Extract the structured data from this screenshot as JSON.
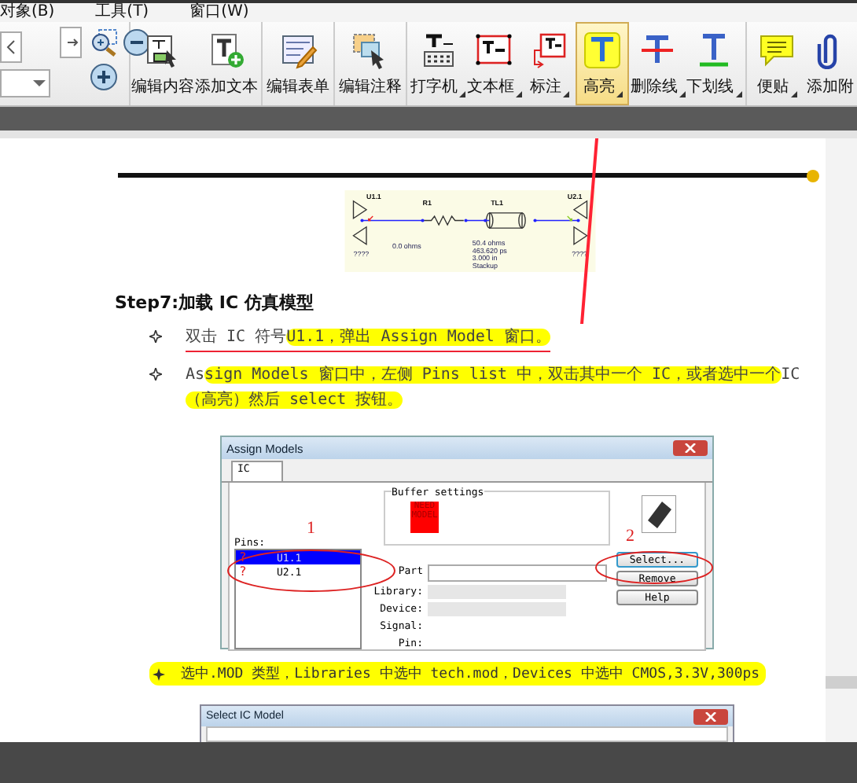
{
  "menu": [
    {
      "label": "对象(B)"
    },
    {
      "label": "工具(T)"
    },
    {
      "label": "窗口(W)"
    }
  ],
  "toolbar": [
    {
      "label": "编辑内容",
      "dropdown": false,
      "selected": false
    },
    {
      "label": "添加文本",
      "dropdown": false,
      "selected": false
    },
    {
      "label": "编辑表单",
      "dropdown": false,
      "selected": false
    },
    {
      "label": "编辑注释",
      "dropdown": false,
      "selected": false
    },
    {
      "label": "打字机",
      "dropdown": true,
      "selected": false
    },
    {
      "label": "文本框",
      "dropdown": true,
      "selected": false
    },
    {
      "label": "标注",
      "dropdown": true,
      "selected": false
    },
    {
      "label": "高亮",
      "dropdown": true,
      "selected": true
    },
    {
      "label": "删除线",
      "dropdown": true,
      "selected": false
    },
    {
      "label": "下划线",
      "dropdown": true,
      "selected": false
    },
    {
      "label": "便贴",
      "dropdown": true,
      "selected": false
    },
    {
      "label": "添加附",
      "dropdown": false,
      "selected": false
    }
  ],
  "document": {
    "schematic": {
      "labels": [
        "U1.1",
        "R1",
        "TL1",
        "U2.1",
        "0.0 ohms",
        "50.4 ohms",
        "463.620 ps",
        "3.000 in",
        "Stackup",
        "????",
        "????"
      ]
    },
    "heading": "Step7:加载 IC 仿真模型",
    "bullets": [
      {
        "underlined": true,
        "lines": [
          [
            {
              "text": "双击 IC 符号",
              "highlight": false
            },
            {
              "text": "U1.1，弹出 Assign Model 窗口。",
              "highlight": true
            }
          ]
        ]
      },
      {
        "underlined": false,
        "lines": [
          [
            {
              "text": "As",
              "highlight": false
            },
            {
              "text": "sign Models 窗口中，左侧 Pins list 中，双击其中一个 IC，或者选中一个",
              "highlight": true
            },
            {
              "text": "IC",
              "highlight": false
            }
          ],
          [
            {
              "text": "（高亮）然后 select 按钮。",
              "highlight": true
            }
          ]
        ]
      }
    ],
    "assign_models": {
      "title": "Assign Models",
      "tab": "IC",
      "group": "Buffer settings",
      "badge": [
        "NEED",
        "MODEL"
      ],
      "pins_label": "Pins:",
      "pins": [
        {
          "label": "U1.1",
          "flag": "?",
          "selected": true
        },
        {
          "label": "U2.1",
          "flag": "?",
          "selected": false
        }
      ],
      "fields": [
        "Part",
        "Library:",
        "Device:",
        "Signal:",
        "Pin:"
      ],
      "buttons": [
        {
          "label": "Select...",
          "focused": true
        },
        {
          "label": "Remove",
          "focused": false
        },
        {
          "label": "Help",
          "focused": false
        }
      ],
      "callouts": [
        "1",
        "2"
      ]
    },
    "bullet_3": {
      "highlighted": true,
      "text": "选中.MOD 类型，Libraries 中选中 tech.mod，Devices 中选中 CMOS,3.3V,300ps"
    },
    "select_ic_model": {
      "title": "Select IC Model"
    }
  }
}
